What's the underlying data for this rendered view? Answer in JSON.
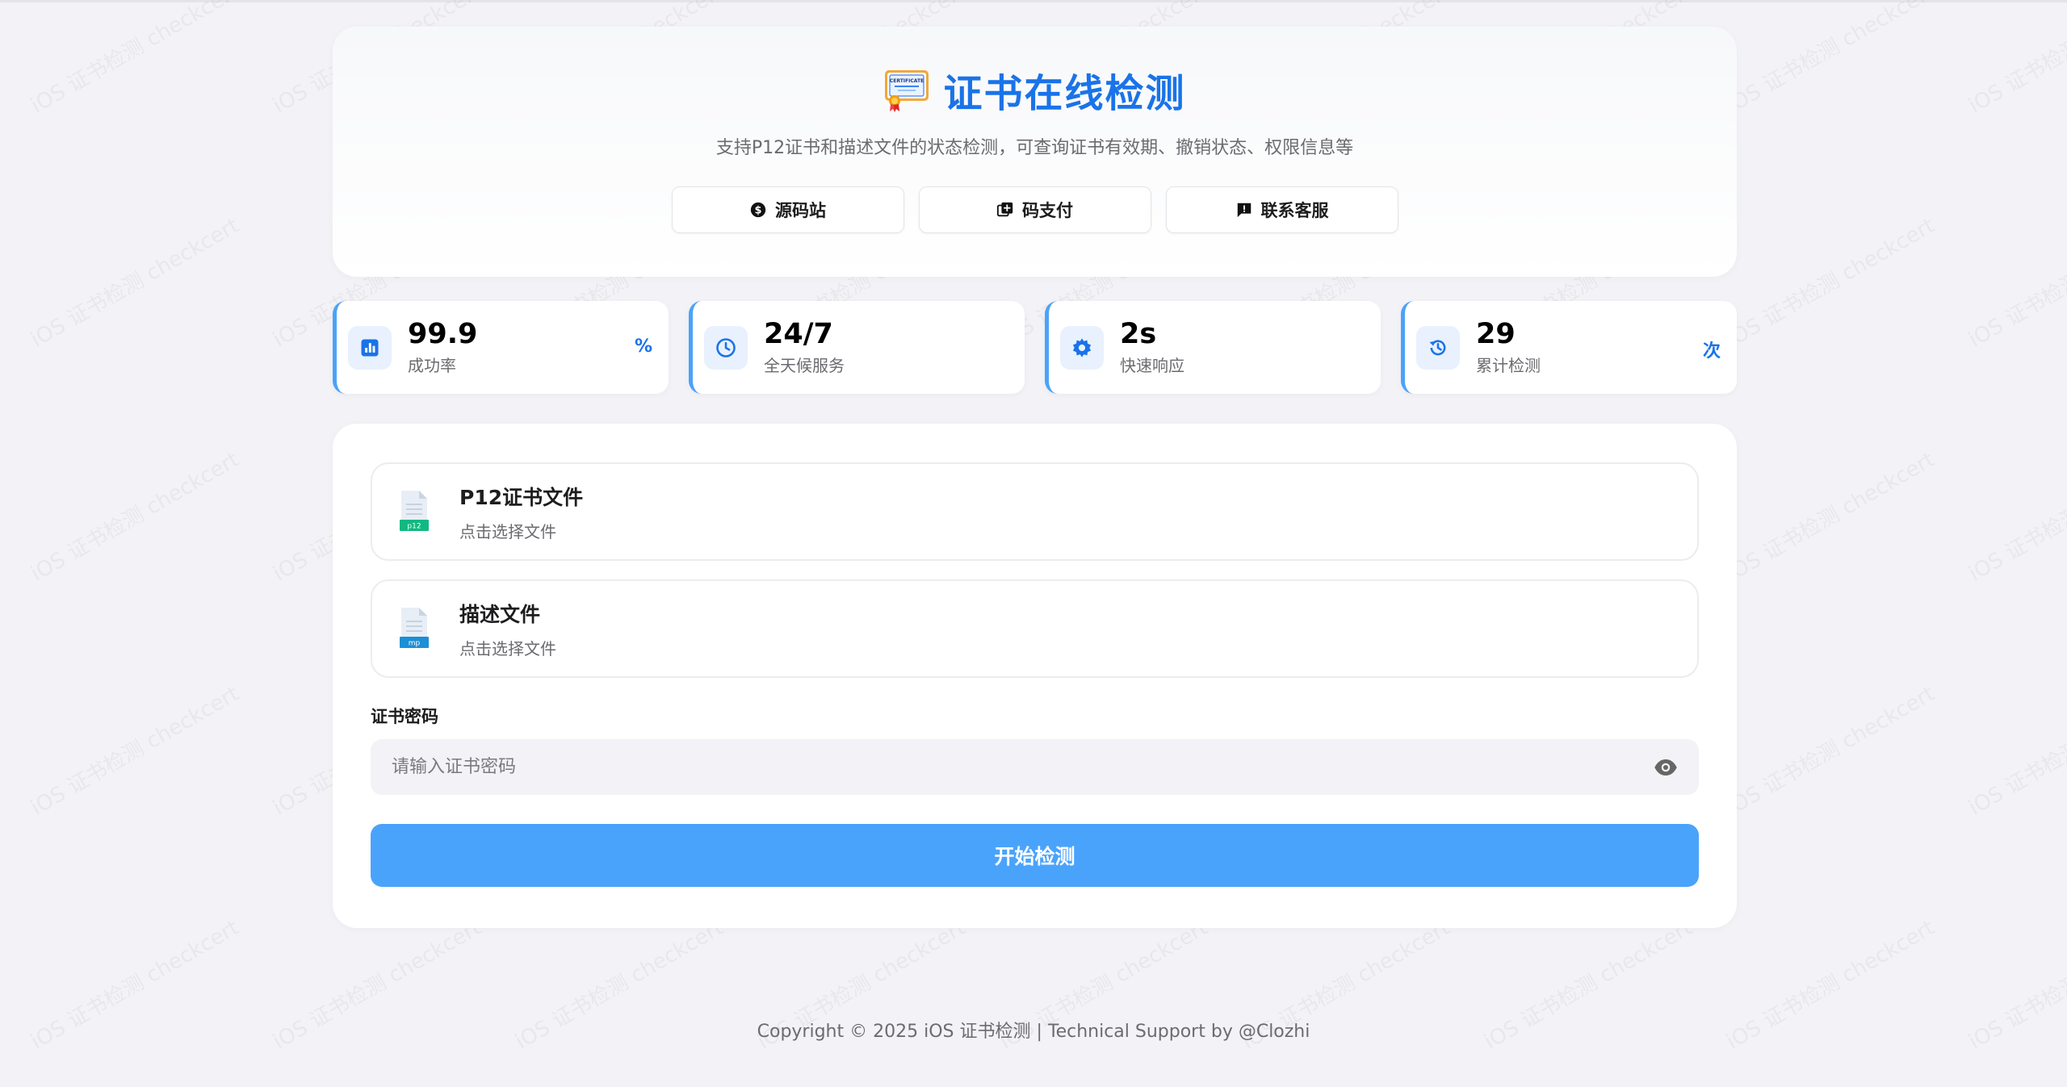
{
  "header": {
    "title": "证书在线检测",
    "subtitle": "支持P12证书和描述文件的状态检测，可查询证书有效期、撤销状态、权限信息等",
    "cert_badge_text": "CERTIFICATE",
    "links": [
      {
        "label": "源码站",
        "icon": "dollar-circle-icon"
      },
      {
        "label": "码支付",
        "icon": "plus-square-icon"
      },
      {
        "label": "联系客服",
        "icon": "chat-alert-icon"
      }
    ]
  },
  "stats": [
    {
      "value": "99.9",
      "label": "成功率",
      "unit": "%",
      "icon": "chart-box-icon"
    },
    {
      "value": "24/7",
      "label": "全天候服务",
      "unit": "",
      "icon": "clock-icon"
    },
    {
      "value": "2s",
      "label": "快速响应",
      "unit": "",
      "icon": "gear-icon"
    },
    {
      "value": "29",
      "label": "累计检测",
      "unit": "次",
      "icon": "history-icon"
    }
  ],
  "upload": {
    "p12": {
      "title": "P12证书文件",
      "hint": "点击选择文件",
      "badge": "p12"
    },
    "profile": {
      "title": "描述文件",
      "hint": "点击选择文件",
      "badge": "mp"
    }
  },
  "password": {
    "label": "证书密码",
    "placeholder": "请输入证书密码"
  },
  "submit_label": "开始检测",
  "footer": "Copyright © 2025 iOS 证书检测 | Technical Support by @Clozhi",
  "watermark_text": "iOS 证书检测 checkcert",
  "colors": {
    "accent": "#1a73e8",
    "button": "#4aa3fb",
    "background": "#f2f2f7",
    "stat_border": "#4aa3f8"
  }
}
